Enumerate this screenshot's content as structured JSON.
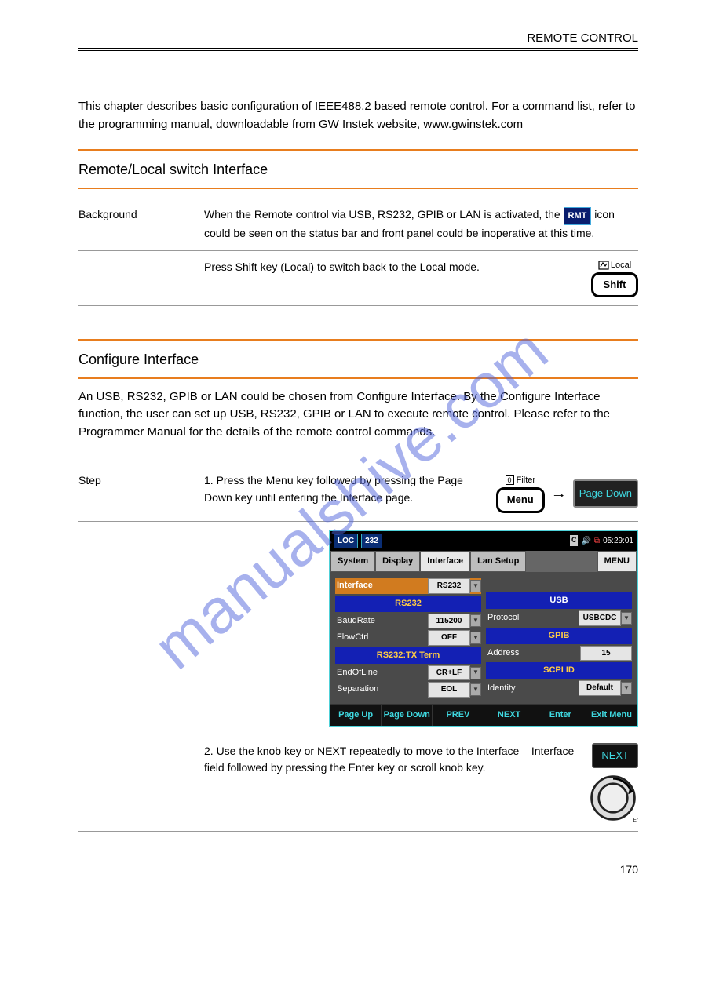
{
  "header": {
    "chapter": "REMOTE CONTROL"
  },
  "intro": "This chapter describes basic configuration of IEEE488.2 based remote control. For a command list, refer to the programming manual, downloadable from GW Instek website, www.gwinstek.com",
  "sections": {
    "remote_local": {
      "title": "Remote/Local switch Interface",
      "background_label": "Background",
      "background_text_before": "When the Remote control via USB, RS232, GPIB or LAN is activated, the ",
      "background_text_after": " icon could be seen on the status bar and front panel could be inoperative at this time.",
      "switch_text": "Press Shift key (Local) to switch back to the Local mode.",
      "shift_above": "Local",
      "shift_key_label": "Shift"
    },
    "configure": {
      "title": "Configure Interface",
      "body1": "An USB, RS232, GPIB or LAN could be chosen from Configure Interface. By the Configure Interface function, the user can set up USB, RS232, GPIB or LAN to execute remote control. Please refer to the Programmer Manual for the details of the remote control commands.",
      "step1_label": "Step",
      "step1_text": "1. Press the Menu key followed by pressing the Page Down key until entering the Interface page.",
      "menu_above": "Filter",
      "menu_key_label": "Menu",
      "pagedown_label": "Page Down",
      "step2_text": "2. Use the knob key or NEXT repeatedly to move to the Interface – Interface field followed by pressing the Enter key or scroll knob key.",
      "next_label": "NEXT"
    }
  },
  "device": {
    "sysbar": {
      "loc": "LOC",
      "mode": "232",
      "batt": "C",
      "time": "05:29:01"
    },
    "tabs": {
      "system": "System",
      "display": "Display",
      "interface": "Interface",
      "lan": "Lan Setup",
      "menu": "MENU"
    },
    "left": {
      "interface_label": "Interface",
      "interface_value": "RS232",
      "rs232_hdr": "RS232",
      "baud_label": "BaudRate",
      "baud_value": "115200",
      "flow_label": "FlowCtrl",
      "flow_value": "OFF",
      "txterm_hdr": "RS232:TX Term",
      "eol_label": "EndOfLine",
      "eol_value": "CR+LF",
      "sep_label": "Separation",
      "sep_value": "EOL"
    },
    "right": {
      "usb_hdr": "USB",
      "proto_label": "Protocol",
      "proto_value": "USBCDC",
      "gpib_hdr": "GPIB",
      "addr_label": "Address",
      "addr_value": "15",
      "scpi_hdr": "SCPI ID",
      "ident_label": "Identity",
      "ident_value": "Default"
    },
    "footer": {
      "b1": "Page Up",
      "b2": "Page Down",
      "b3": "PREV",
      "b4": "NEXT",
      "b5": "Enter",
      "b6": "Exit Menu"
    }
  },
  "page_number": "170",
  "watermark": "manualshive.com"
}
